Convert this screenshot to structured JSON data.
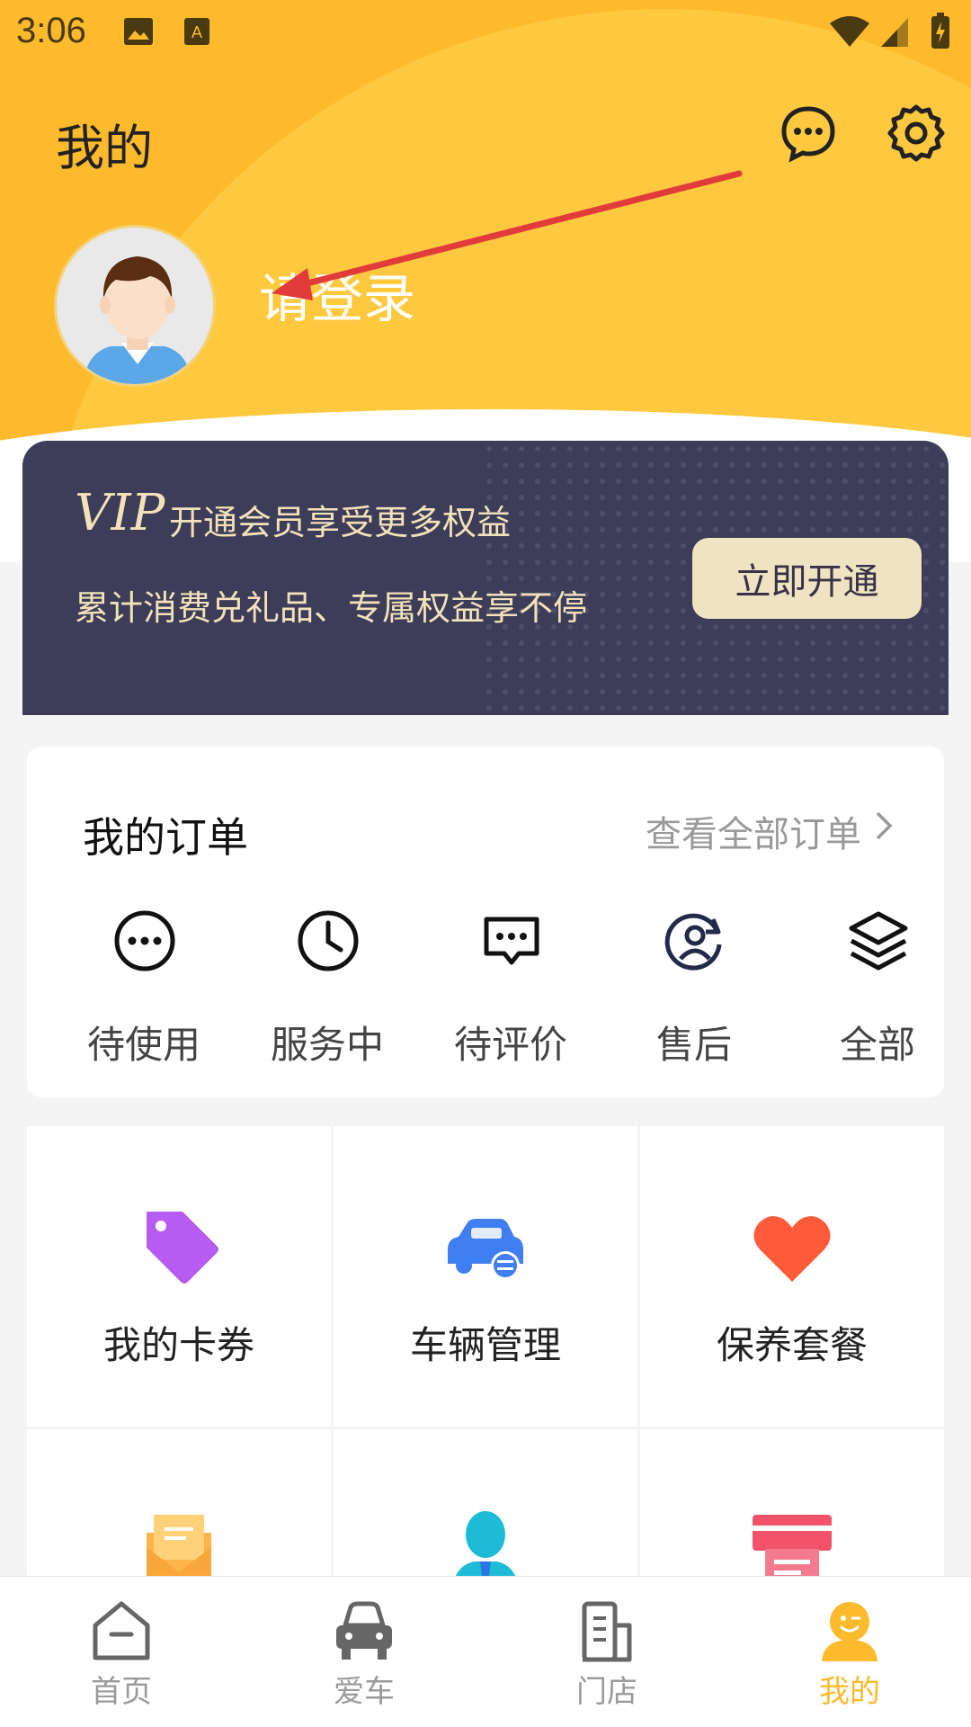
{
  "status_bar": {
    "time": "3:06"
  },
  "header": {
    "title": "我的",
    "login_prompt": "请登录"
  },
  "vip": {
    "badge": "VIP",
    "title": "开通会员享受更多权益",
    "subtitle": "累计消费兑礼品、专属权益享不停",
    "button": "立即开通"
  },
  "orders": {
    "title": "我的订单",
    "view_all": "查看全部订单",
    "items": [
      {
        "label": "待使用",
        "icon": "more-dots-icon"
      },
      {
        "label": "服务中",
        "icon": "clock-icon"
      },
      {
        "label": "待评价",
        "icon": "chat-bubble-icon"
      },
      {
        "label": "售后",
        "icon": "refund-user-icon"
      },
      {
        "label": "全部",
        "icon": "layers-icon"
      }
    ]
  },
  "services": [
    {
      "label": "我的卡券",
      "icon": "coupon-tag-icon",
      "color": "#B65CF2"
    },
    {
      "label": "车辆管理",
      "icon": "car-manage-icon",
      "color": "#3F7FF3"
    },
    {
      "label": "保养套餐",
      "icon": "heart-icon",
      "color": "#FF5B3A"
    },
    {
      "label": "",
      "icon": "envelope-icon",
      "color": "#FDB54A"
    },
    {
      "label": "",
      "icon": "user-tie-icon",
      "color": "#1DBBD6"
    },
    {
      "label": "",
      "icon": "printer-icon",
      "color": "#F2536B"
    }
  ],
  "tabbar": {
    "items": [
      {
        "label": "首页",
        "icon": "home-icon"
      },
      {
        "label": "爱车",
        "icon": "car-icon"
      },
      {
        "label": "门店",
        "icon": "store-icon"
      },
      {
        "label": "我的",
        "icon": "me-icon",
        "active": true
      }
    ]
  },
  "colors": {
    "accent": "#FDBA2C",
    "vip_bg": "#3D3C59",
    "vip_text": "#F1E2B9"
  }
}
